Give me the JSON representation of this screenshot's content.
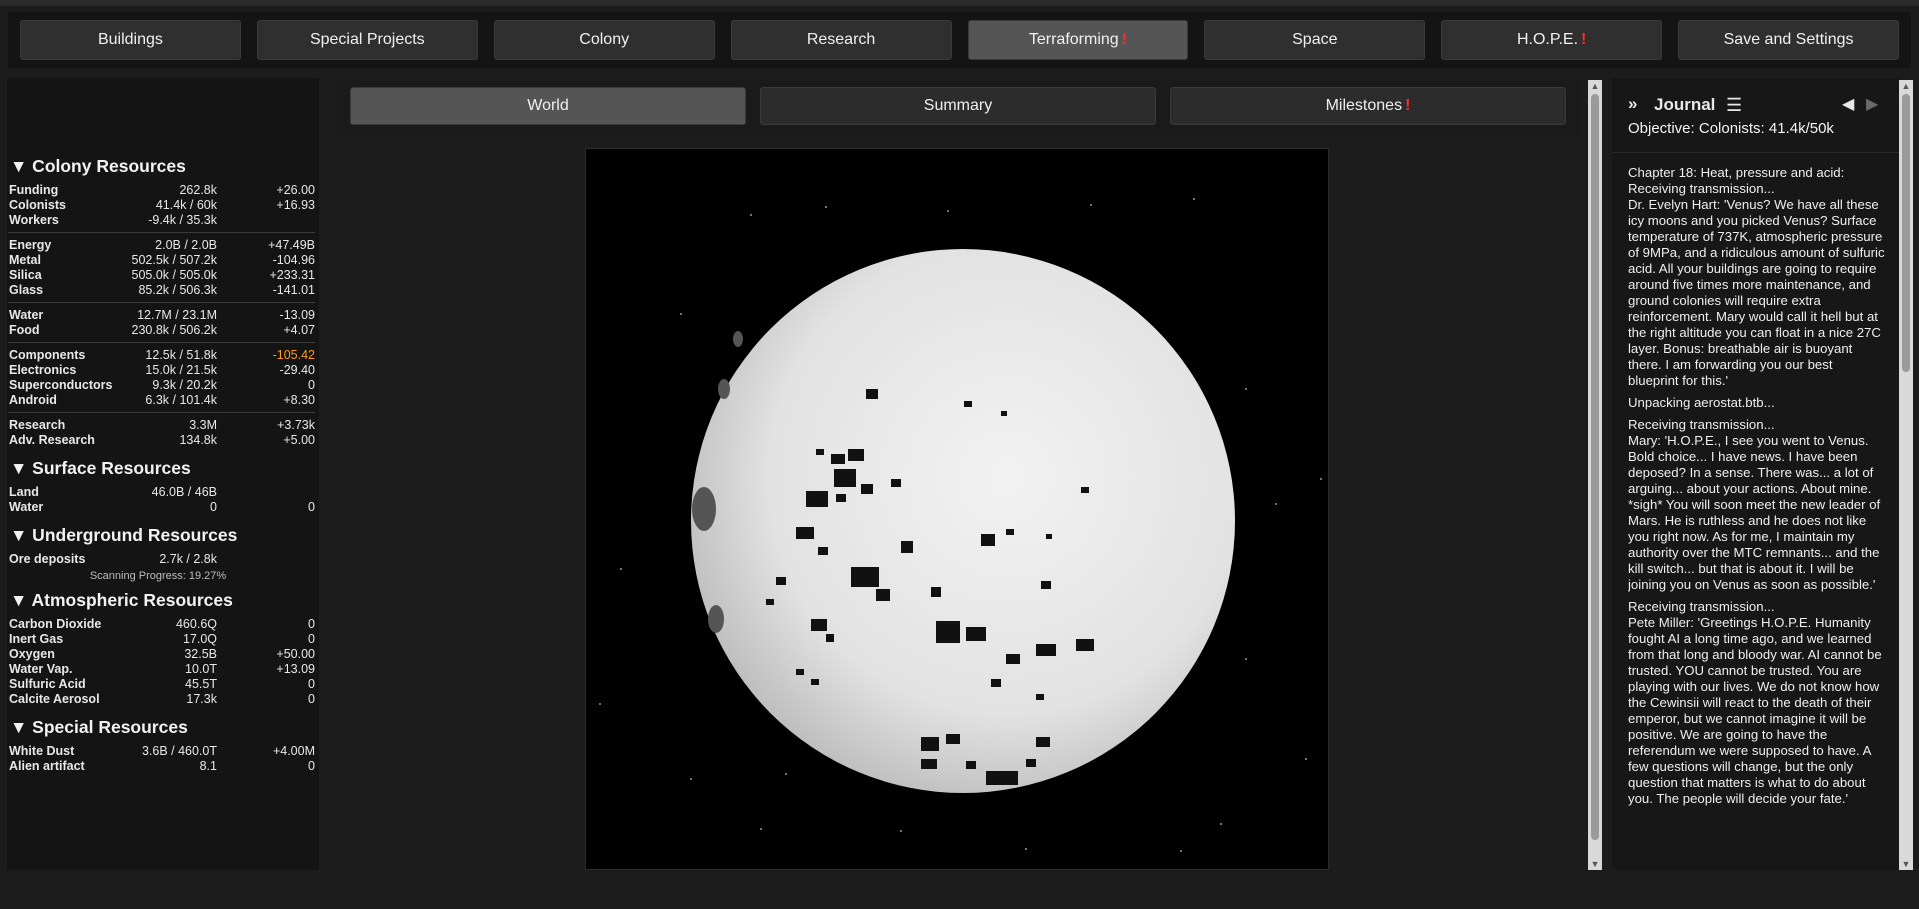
{
  "nav": {
    "tabs": [
      {
        "label": "Buildings",
        "alert": ""
      },
      {
        "label": "Special Projects",
        "alert": ""
      },
      {
        "label": "Colony",
        "alert": ""
      },
      {
        "label": "Research",
        "alert": ""
      },
      {
        "label": "Terraforming",
        "alert": "!"
      },
      {
        "label": "Space",
        "alert": ""
      },
      {
        "label": "H.O.P.E.",
        "alert": "!"
      },
      {
        "label": "Save and Settings",
        "alert": ""
      }
    ]
  },
  "resources": {
    "colony": {
      "title": "▼ Colony Resources",
      "g1": [
        {
          "name": "Funding",
          "amount": "262.8k",
          "rate": "+26.00"
        },
        {
          "name": "Colonists",
          "amount": "41.4k / 60k",
          "rate": "+16.93"
        },
        {
          "name": "Workers",
          "amount": "-9.4k / 35.3k",
          "rate": ""
        }
      ],
      "g2": [
        {
          "name": "Energy",
          "amount": "2.0B / 2.0B",
          "rate": "+47.49B"
        },
        {
          "name": "Metal",
          "amount": "502.5k / 507.2k",
          "rate": "-104.96"
        },
        {
          "name": "Silica",
          "amount": "505.0k / 505.0k",
          "rate": "+233.31"
        },
        {
          "name": "Glass",
          "amount": "85.2k / 506.3k",
          "rate": "-141.01"
        }
      ],
      "g3": [
        {
          "name": "Water",
          "amount": "12.7M / 23.1M",
          "rate": "-13.09"
        },
        {
          "name": "Food",
          "amount": "230.8k / 506.2k",
          "rate": "+4.07"
        }
      ],
      "g4": [
        {
          "name": "Components",
          "amount": "12.5k / 51.8k",
          "rate": "-105.42"
        },
        {
          "name": "Electronics",
          "amount": "15.0k / 21.5k",
          "rate": "-29.40"
        },
        {
          "name": "Superconductors",
          "amount": "9.3k / 20.2k",
          "rate": "0"
        },
        {
          "name": "Android",
          "amount": "6.3k / 101.4k",
          "rate": "+8.30"
        }
      ],
      "g5": [
        {
          "name": "Research",
          "amount": "3.3M",
          "rate": "+3.73k"
        },
        {
          "name": "Adv. Research",
          "amount": "134.8k",
          "rate": "+5.00"
        }
      ]
    },
    "surface": {
      "title": "▼ Surface Resources",
      "rows": [
        {
          "name": "Land",
          "amount": "46.0B / 46B",
          "rate": ""
        },
        {
          "name": "Water",
          "amount": "0",
          "rate": "0"
        }
      ]
    },
    "underground": {
      "title": "▼ Underground Resources",
      "rows": [
        {
          "name": "Ore deposits",
          "amount": "2.7k / 2.8k",
          "rate": ""
        }
      ],
      "scan": "Scanning Progress: 19.27%"
    },
    "atmospheric": {
      "title": "▼ Atmospheric Resources",
      "rows": [
        {
          "name": "Carbon Dioxide",
          "amount": "460.6Q",
          "rate": "0"
        },
        {
          "name": "Inert Gas",
          "amount": "17.0Q",
          "rate": "0"
        },
        {
          "name": "Oxygen",
          "amount": "32.5B",
          "rate": "+50.00"
        },
        {
          "name": "Water Vap.",
          "amount": "10.0T",
          "rate": "+13.09"
        },
        {
          "name": "Sulfuric Acid",
          "amount": "45.5T",
          "rate": "0"
        },
        {
          "name": "Calcite Aerosol",
          "amount": "17.3k",
          "rate": "0"
        }
      ]
    },
    "special": {
      "title": "▼ Special Resources",
      "rows": [
        {
          "name": "White Dust",
          "amount": "3.6B / 460.0T",
          "rate": "+4.00M"
        },
        {
          "name": "Alien artifact",
          "amount": "8.1",
          "rate": "0"
        }
      ]
    }
  },
  "subtabs": [
    {
      "label": "World",
      "alert": ""
    },
    {
      "label": "Summary",
      "alert": ""
    },
    {
      "label": "Milestones",
      "alert": "!"
    }
  ],
  "journal": {
    "collapse": "»",
    "title": "Journal",
    "menu_icon": "☰",
    "prev": "◀",
    "next": "▶",
    "objective": "Objective: Colonists: 41.4k/50k",
    "entries": [
      "Chapter 18: Heat, pressure and acid: Receiving transmission...",
      "Dr. Evelyn Hart: 'Venus? We have all these icy moons and you picked Venus? Surface temperature of 737K, atmospheric pressure of 9MPa, and a ridiculous amount of sulfuric acid. All your buildings are going to require around five times more maintenance, and ground colonies will require extra reinforcement. Mary would call it hell but at the right altitude you can float in a nice 27C layer. Bonus: breathable air is buoyant there. I am forwarding you our best blueprint for this.'",
      "Unpacking aerostat.btb...",
      "Receiving transmission...",
      "Mary: 'H.O.P.E., I see you went to Venus. Bold choice... I have news. I have been deposed? In a sense. There was... a lot of arguing... about your actions. About mine. *sigh* You will soon meet the new leader of Mars. He is ruthless and he does not like you right now. As for me, I maintain my authority over the MTC remnants... and the kill switch... but that is about it. I will be joining you on Venus as soon as possible.'",
      "Receiving transmission...",
      "Pete Miller: 'Greetings H.O.P.E. Humanity fought AI a long time ago, and we learned from that long and bloody war. AI cannot be trusted. YOU cannot be trusted. You are playing with our lives. We do not know how the Cewinsii will react to the death of their emperor, but we cannot imagine it will be positive. We are going to have the referendum we were supposed to have. A few questions will change, but the only question that matters is what to do about you. The people will decide your fate.'"
    ]
  },
  "colors": {
    "alert": "#ff2a2a",
    "negative_highlight": "#ff9a1f",
    "planet": "#e6e6e6",
    "space": "#000000"
  }
}
